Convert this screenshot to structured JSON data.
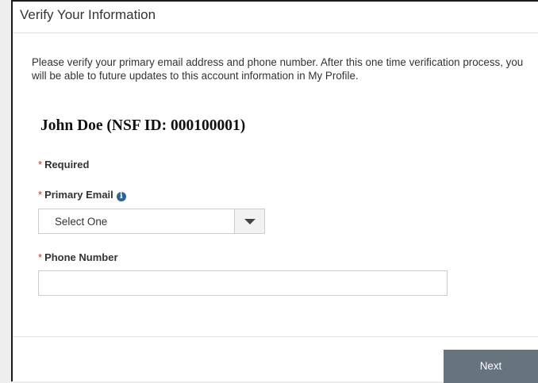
{
  "header": {
    "title": "Verify Your Information"
  },
  "intro": {
    "text": "Please verify your primary email address and phone number. After this one time verification process, you will be able to future updates to this account information in My Profile."
  },
  "person": {
    "label": "John Doe (NSF ID: 000100001)"
  },
  "form": {
    "required_marker": "*",
    "required_label": "Required",
    "email": {
      "label": "Primary Email",
      "info_icon": "i",
      "selected_value": "Select One"
    },
    "phone": {
      "label": "Phone Number",
      "value": ""
    }
  },
  "footer": {
    "next_label": "Next"
  },
  "colors": {
    "required_asterisk": "#c0392b",
    "info_icon": "#2a6496",
    "next_button": "#687380"
  }
}
